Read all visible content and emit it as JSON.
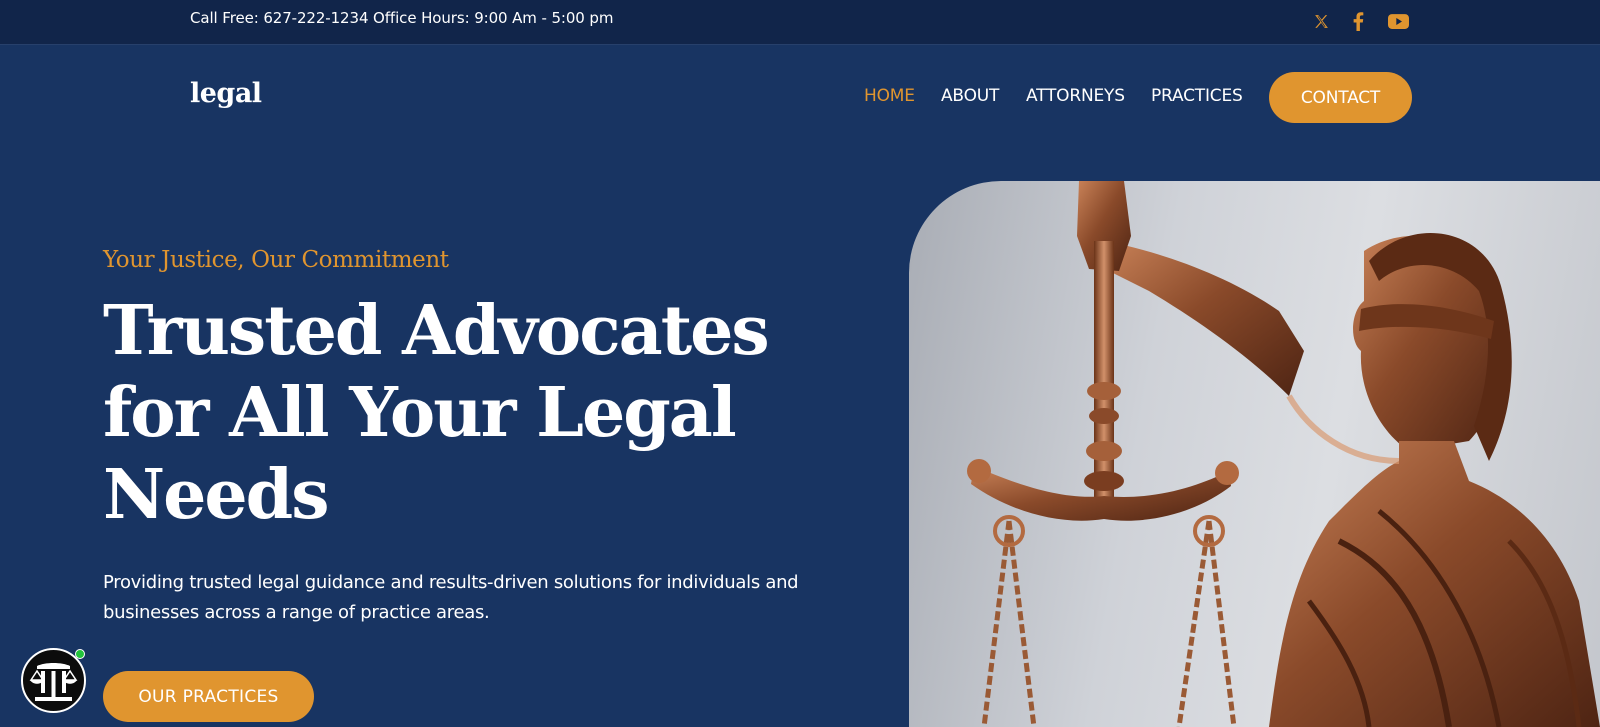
{
  "topbar": {
    "info_text": "Call Free: 627-222-1234 Office Hours: 9:00 Am - 5:00 pm",
    "social": [
      {
        "icon": "x-twitter-icon"
      },
      {
        "icon": "facebook-icon"
      },
      {
        "icon": "youtube-icon"
      }
    ]
  },
  "header": {
    "logo": "legal",
    "nav": [
      {
        "label": "HOME",
        "active": true
      },
      {
        "label": "ABOUT",
        "active": false
      },
      {
        "label": "ATTORNEYS",
        "active": false
      },
      {
        "label": "PRACTICES",
        "active": false
      }
    ],
    "contact_label": "CONTACT"
  },
  "hero": {
    "tagline": "Your Justice, Our Commitment",
    "headline": "Trusted Advocates for All Your Legal Needs",
    "description": "Providing trusted legal guidance and results-driven solutions for individuals and businesses across a range of practice areas.",
    "cta_label": "OUR PRACTICES",
    "image": "lady-justice-statue-image"
  },
  "widget": {
    "icon": "scales-columns-icon",
    "status": "online"
  },
  "colors": {
    "background": "#183462",
    "topbar": "#11254a",
    "accent": "#e0952f",
    "text": "#ffffff"
  }
}
